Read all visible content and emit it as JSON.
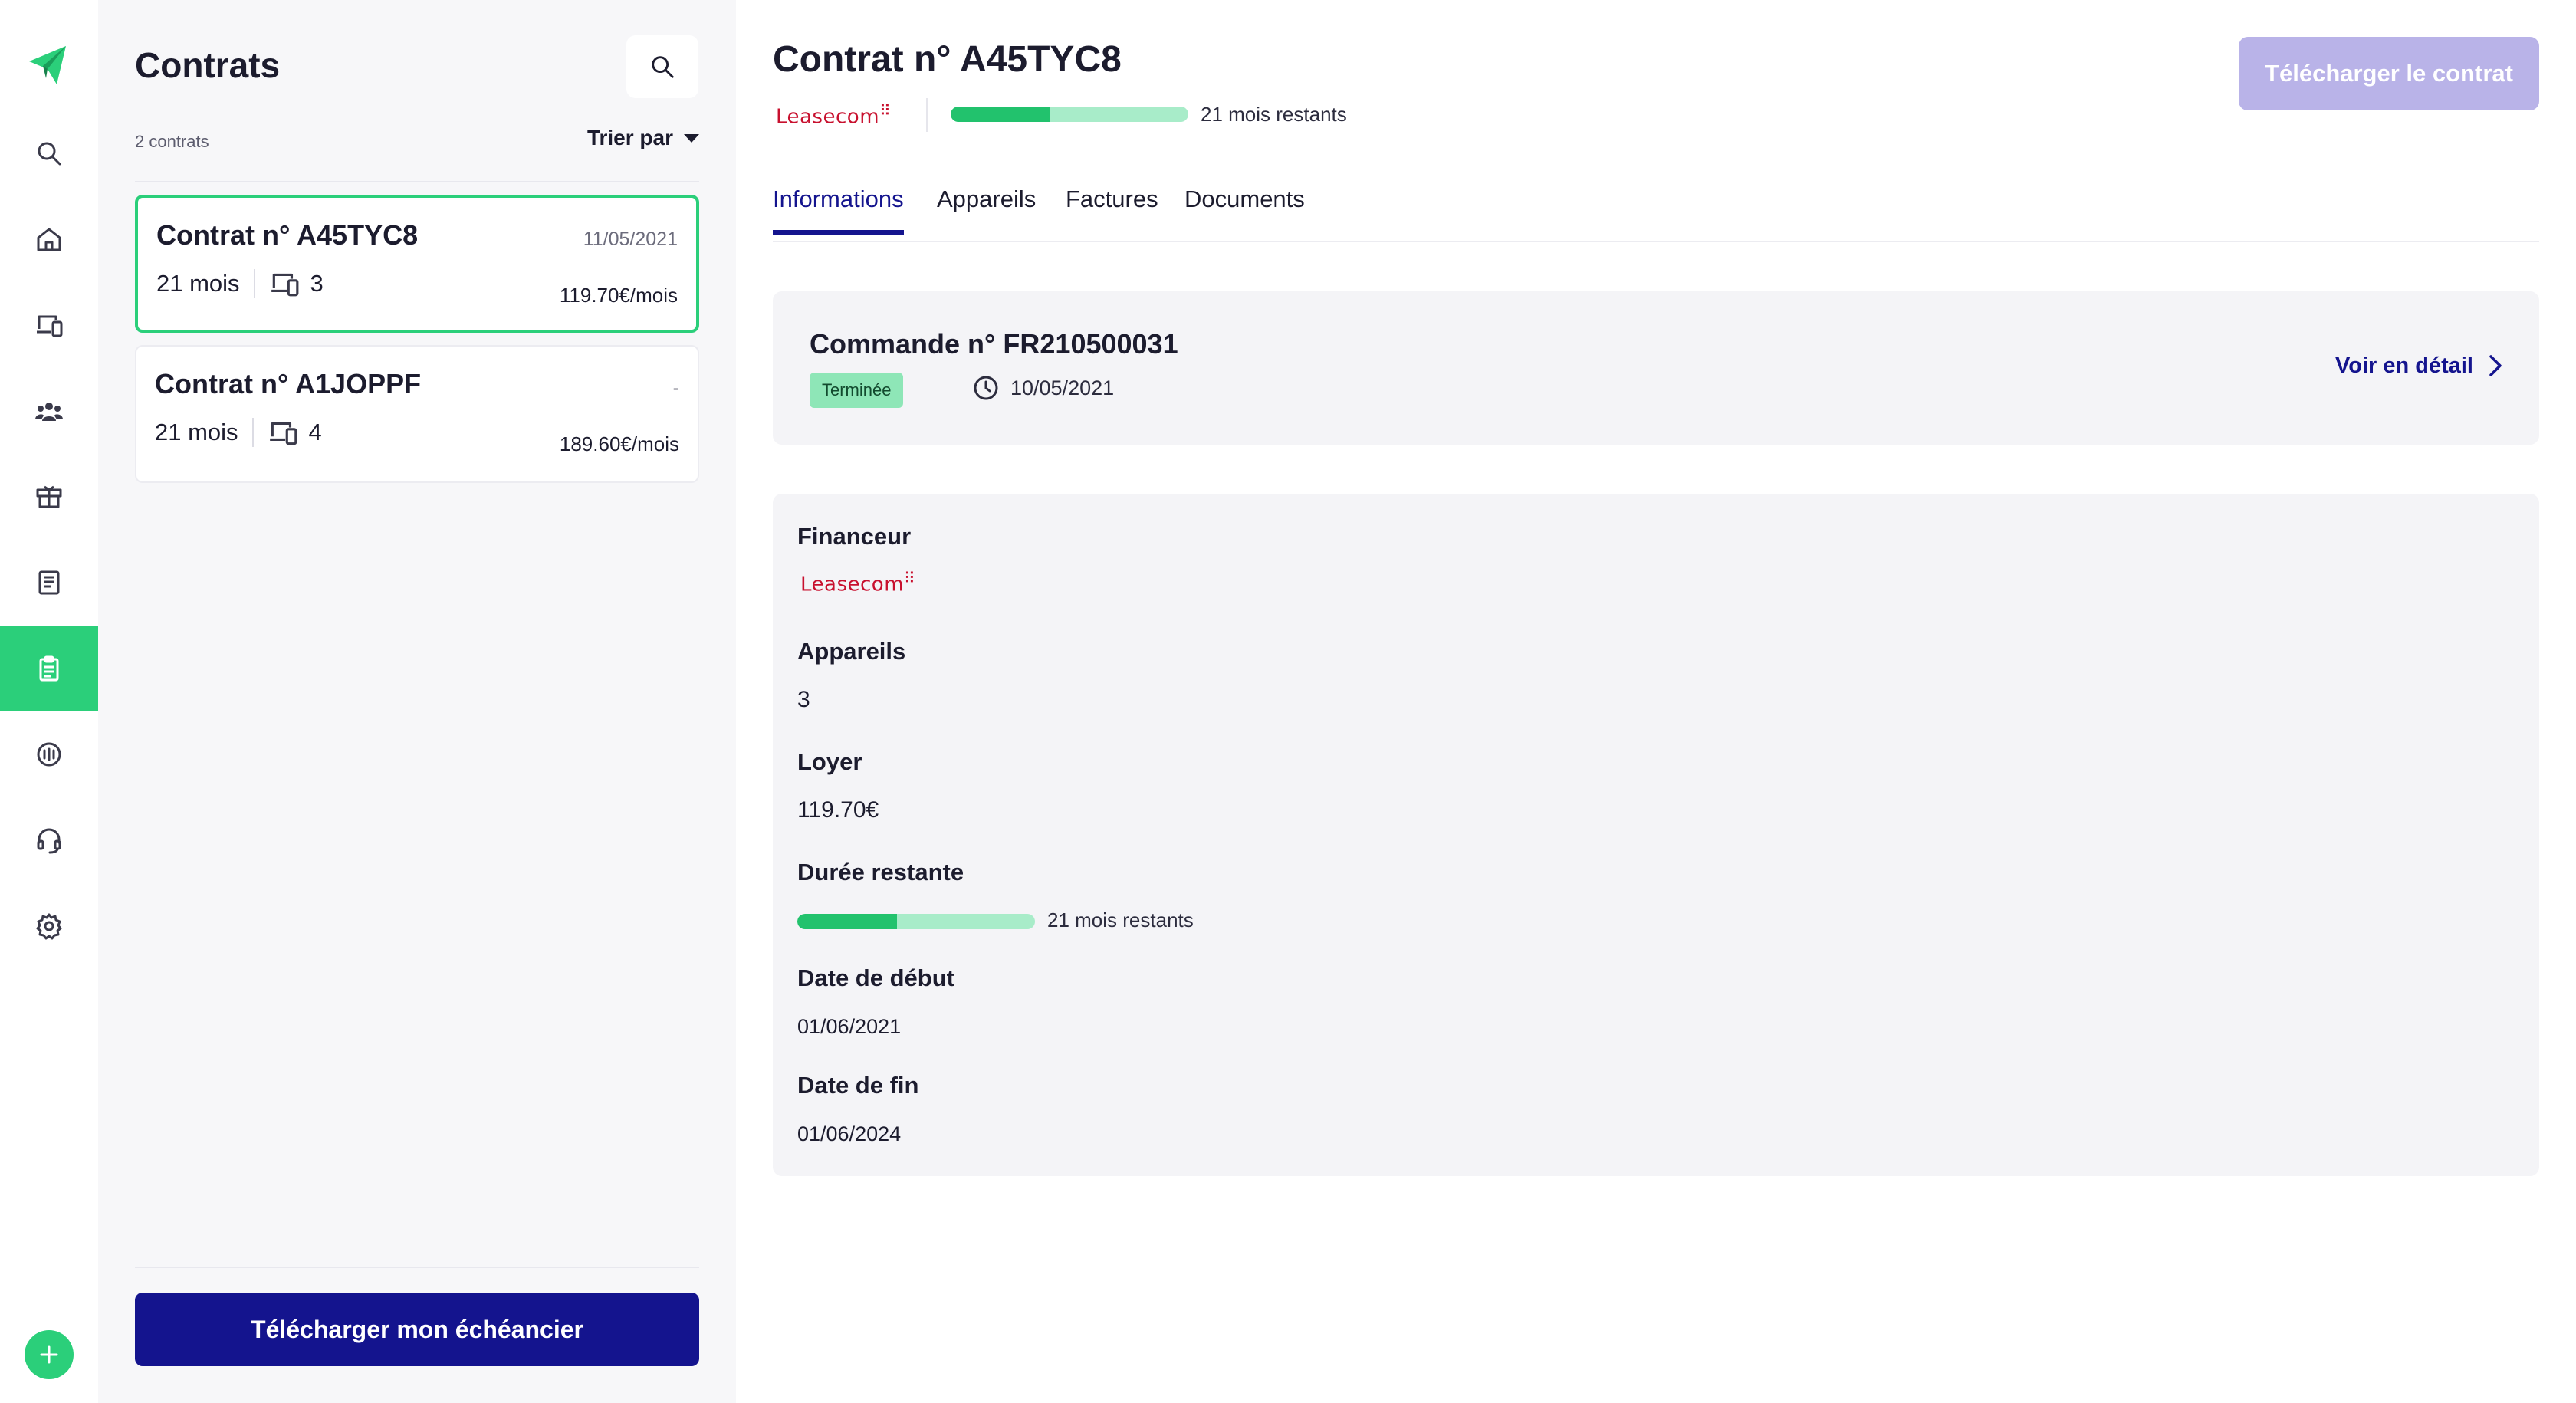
{
  "app": {
    "accent_color": "#2bcf7a",
    "primary_color": "#14148e"
  },
  "rail": {
    "items": [
      {
        "name": "search-icon"
      },
      {
        "name": "home-icon"
      },
      {
        "name": "devices-icon"
      },
      {
        "name": "users-icon"
      },
      {
        "name": "box-icon"
      },
      {
        "name": "book-icon"
      },
      {
        "name": "clipboard-icon",
        "active": true
      },
      {
        "name": "tips-icon"
      },
      {
        "name": "headset-icon"
      },
      {
        "name": "gear-icon"
      }
    ],
    "add_icon": "plus-icon"
  },
  "list": {
    "title": "Contrats",
    "count": "2 contrats",
    "sort_label": "Trier par",
    "contracts": [
      {
        "title": "Contrat n° A45TYC8",
        "date": "11/05/2021",
        "duration": "21 mois",
        "devices": "3",
        "price": "119.70€/mois",
        "selected": true
      },
      {
        "title": "Contrat n° A1JOPPF",
        "date": "-",
        "duration": "21 mois",
        "devices": "4",
        "price": "189.60€/mois",
        "selected": false
      }
    ],
    "download_button": "Télécharger mon échéancier"
  },
  "header": {
    "title": "Contrat n° A45TYC8",
    "lessor_logo": "Leasecom",
    "progress": 0.42,
    "remaining": "21 mois restants",
    "download_button": "Télécharger le contrat"
  },
  "tabs": [
    {
      "label": "Informations",
      "active": true
    },
    {
      "label": "Appareils",
      "active": false
    },
    {
      "label": "Factures",
      "active": false
    },
    {
      "label": "Documents",
      "active": false
    }
  ],
  "order": {
    "title": "Commande n° FR210500031",
    "status": "Terminée",
    "date": "10/05/2021",
    "link": "Voir en détail"
  },
  "info": {
    "financer_label": "Financeur",
    "financer_logo": "Leasecom",
    "devices_label": "Appareils",
    "devices_value": "3",
    "rent_label": "Loyer",
    "rent_value": "119.70€",
    "remaining_label": "Durée restante",
    "remaining_progress": 0.42,
    "remaining_value": "21 mois restants",
    "start_label": "Date de début",
    "start_value": "01/06/2021",
    "end_label": "Date de fin",
    "end_value": "01/06/2024"
  }
}
